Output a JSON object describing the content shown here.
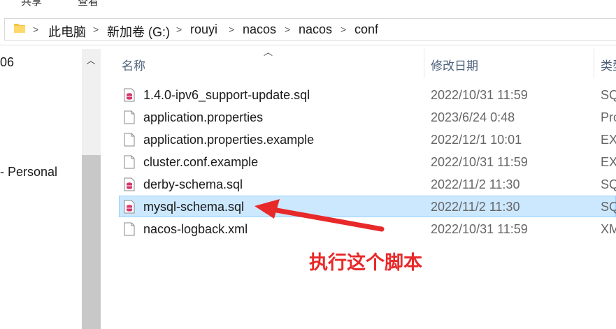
{
  "ribbon": {
    "frag1": "共享",
    "frag2": "查看"
  },
  "breadcrumb": [
    "此电脑",
    "新加卷 (G:)",
    "rouyi",
    "nacos",
    "nacos",
    "conf"
  ],
  "nav": {
    "item1": "06",
    "item2": "- Personal"
  },
  "columns": {
    "name": "名称",
    "date": "修改日期",
    "type": "类型"
  },
  "files": [
    {
      "name": "1.4.0-ipv6_support-update.sql",
      "date": "2022/10/31 11:59",
      "type": "SQL",
      "icon": "sql-file-icon"
    },
    {
      "name": "application.properties",
      "date": "2023/6/24 0:48",
      "type": "Pro",
      "icon": "file-icon"
    },
    {
      "name": "application.properties.example",
      "date": "2022/12/1 10:01",
      "type": "EX",
      "icon": "file-icon"
    },
    {
      "name": "cluster.conf.example",
      "date": "2022/10/31 11:59",
      "type": "EX",
      "icon": "file-icon"
    },
    {
      "name": "derby-schema.sql",
      "date": "2022/11/2 11:30",
      "type": "SQ",
      "icon": "sql-file-icon"
    },
    {
      "name": "mysql-schema.sql",
      "date": "2022/11/2 11:30",
      "type": "SQ",
      "icon": "sql-file-icon",
      "selected": true
    },
    {
      "name": "nacos-logback.xml",
      "date": "2022/10/31 11:59",
      "type": "XM",
      "icon": "xml-file-icon"
    }
  ],
  "annotation": {
    "text": "执行这个脚本",
    "color": "#e8292a"
  }
}
